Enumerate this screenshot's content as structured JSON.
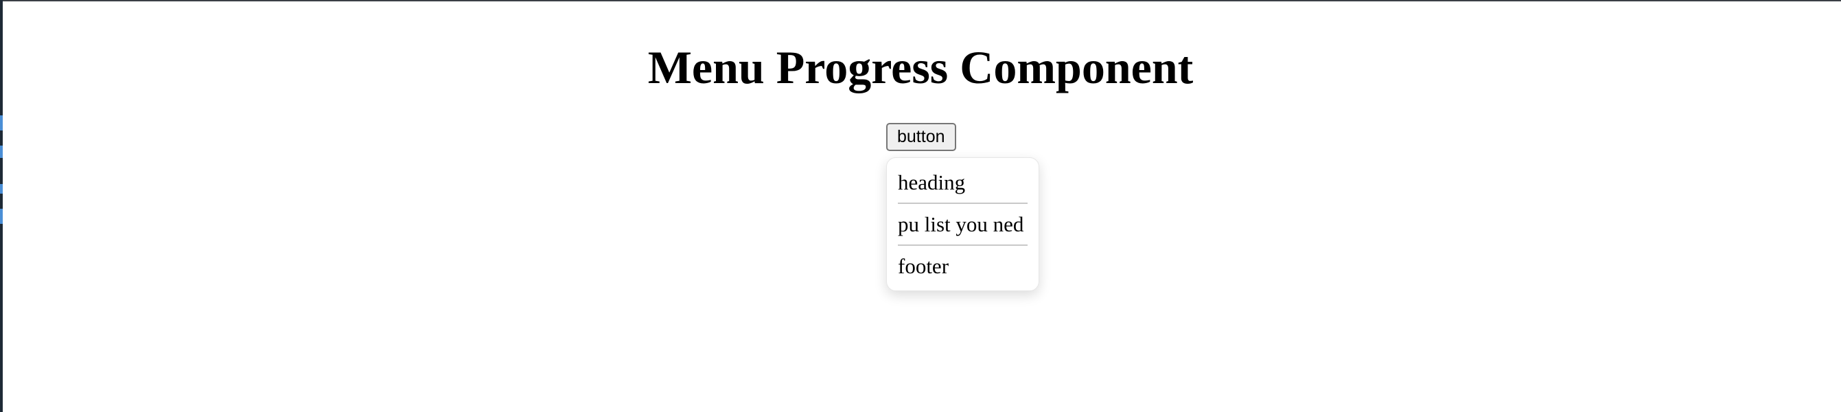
{
  "page": {
    "title": "Menu Progress Component"
  },
  "menu": {
    "button_label": "button",
    "items": [
      {
        "label": "heading"
      },
      {
        "label": "pu list you ned"
      },
      {
        "label": "footer"
      }
    ]
  },
  "colors": {
    "background": "#ffffff",
    "text": "#000000",
    "button_background": "#efefef",
    "button_border": "#767676",
    "divider": "#c8c8c8"
  }
}
